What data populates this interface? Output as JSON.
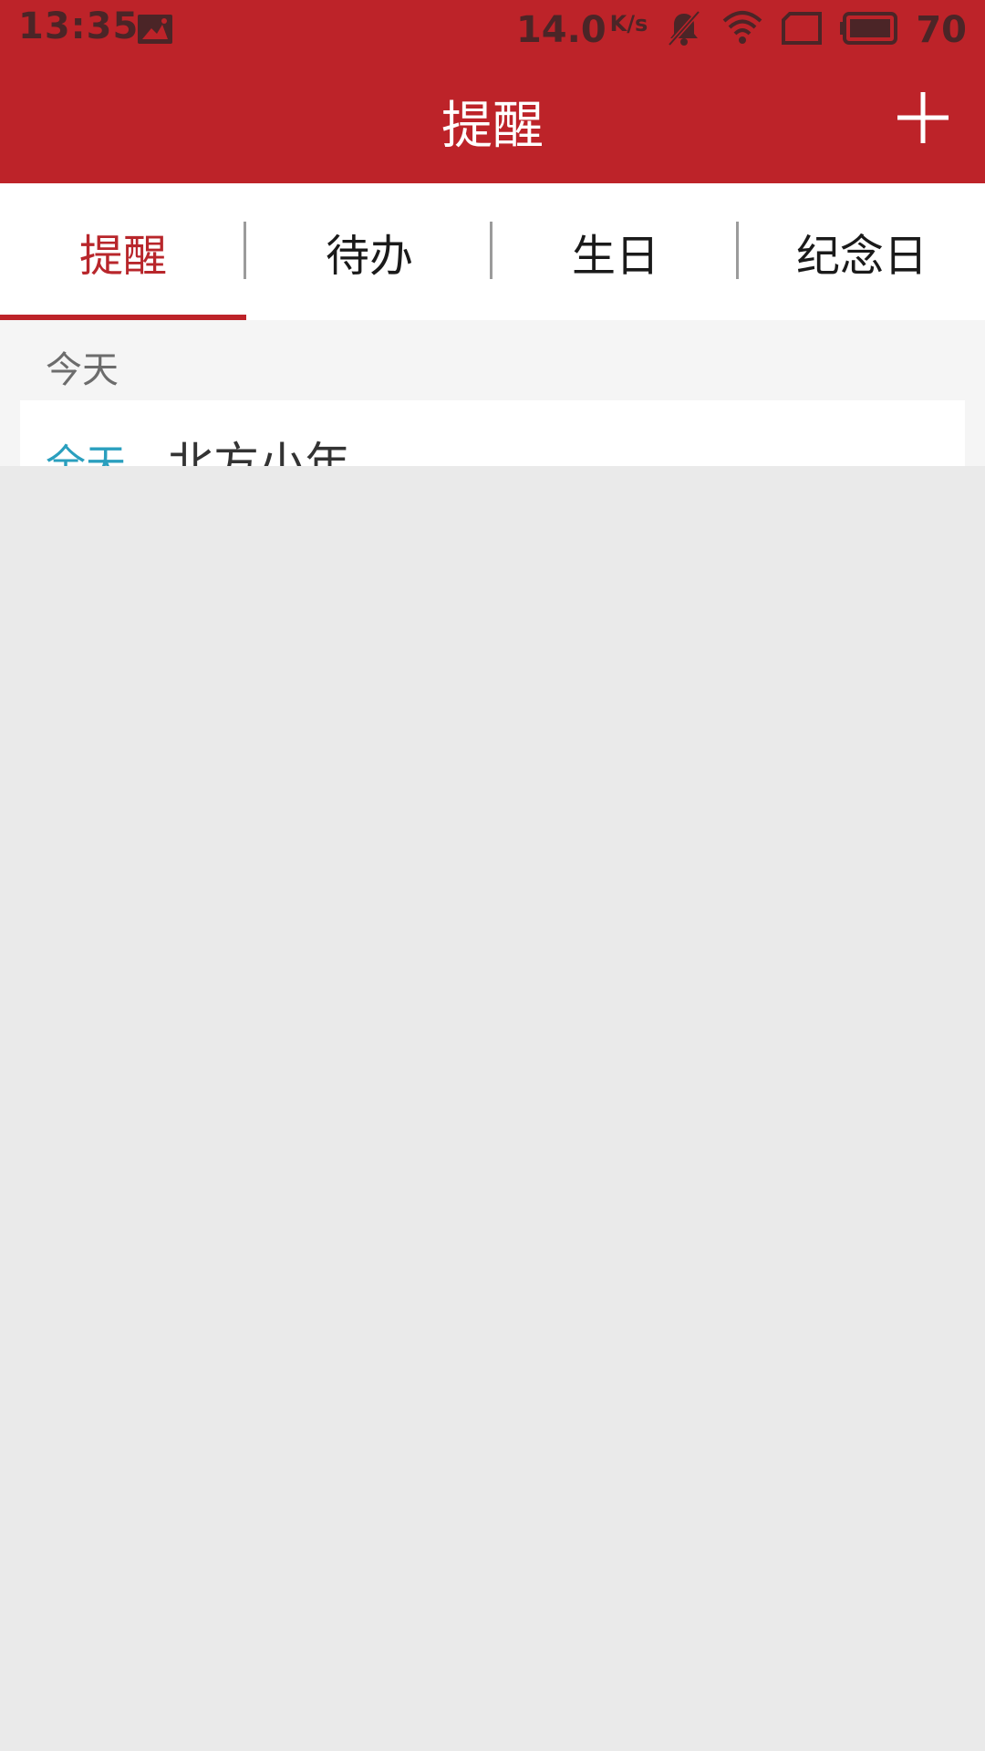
{
  "status_bar": {
    "time": "13:35",
    "net_speed": "14.0",
    "net_speed_unit": "K/s",
    "battery": "70"
  },
  "app_bar": {
    "title": "提醒"
  },
  "tabs": [
    {
      "label": "提醒",
      "active": true
    },
    {
      "label": "待办",
      "active": false
    },
    {
      "label": "生日",
      "active": false
    },
    {
      "label": "纪念日",
      "active": false
    }
  ],
  "list": {
    "section": "今天",
    "items": [
      {
        "time": "全天",
        "title": "北方小年"
      }
    ]
  },
  "colors": {
    "brand": "#bd2329",
    "time_accent": "#2a9fbe"
  }
}
